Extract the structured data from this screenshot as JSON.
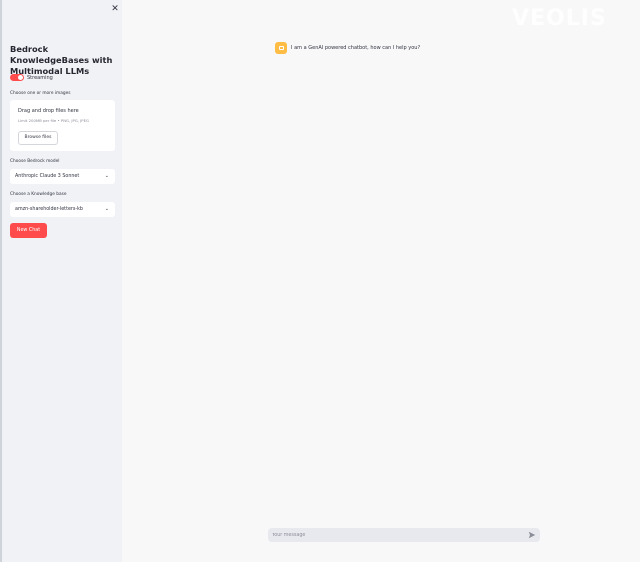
{
  "sidebar": {
    "close_label": "✕",
    "title": "Bedrock KnowledgeBases with Multimodal LLMs",
    "streaming_label": "Streaming",
    "streaming_on": true,
    "images_label": "Choose one or more images",
    "dropzone": {
      "title": "Drag and drop files here",
      "subtitle": "Limit 200MB per file • PNG, JPG, JPEG",
      "browse_label": "Browse files"
    },
    "model_label": "Choose Bedrock model",
    "model_value": "Anthropic Claude 3 Sonnet",
    "kb_label": "Choose a Knowledge base",
    "kb_value": "amzn-shareholder-letters-kb",
    "new_chat_label": "New Chat"
  },
  "watermark": "VEOLIS",
  "chat": {
    "assistant_message": "I am a GenAI powered chatbot, how can I help you?",
    "input_placeholder": "Your message"
  },
  "colors": {
    "accent": "#ff4b4b",
    "sidebar_bg": "#f0f2f6",
    "main_bg": "#f8f8f9",
    "avatar_bg": "#ffbd45"
  },
  "icons": {
    "close": "close-icon",
    "chevron": "chevron-down-icon",
    "avatar": "bot-avatar-icon",
    "send": "send-icon"
  }
}
